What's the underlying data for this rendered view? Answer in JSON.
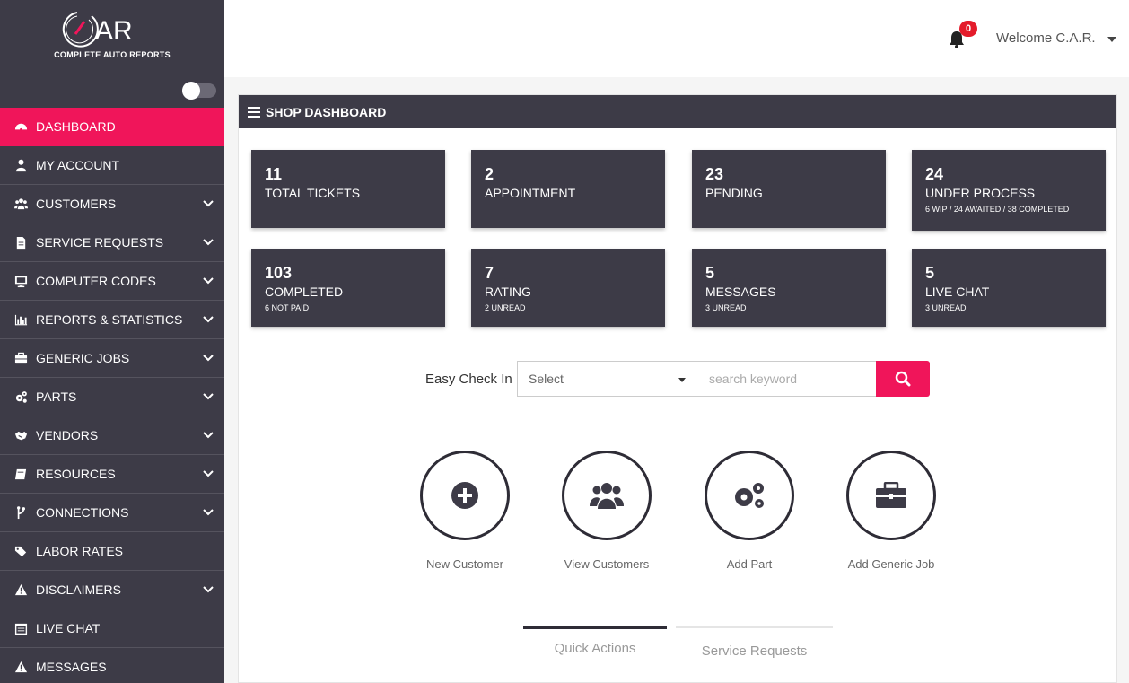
{
  "brand": {
    "logo_text": "AR",
    "subtitle": "COMPLETE AUTO REPORTS",
    "accent": "#f0155a",
    "dark": "#3d3b47"
  },
  "sidebar": {
    "items": [
      {
        "label": "DASHBOARD",
        "icon": "dashboard-icon",
        "active": true,
        "expandable": false
      },
      {
        "label": "MY ACCOUNT",
        "icon": "user-icon",
        "expandable": false
      },
      {
        "label": "CUSTOMERS",
        "icon": "users-icon",
        "expandable": true
      },
      {
        "label": "SERVICE REQUESTS",
        "icon": "document-icon",
        "expandable": true
      },
      {
        "label": "COMPUTER CODES",
        "icon": "monitor-icon",
        "expandable": true
      },
      {
        "label": "REPORTS & STATISTICS",
        "icon": "bar-chart-icon",
        "expandable": true
      },
      {
        "label": "GENERIC JOBS",
        "icon": "briefcase-icon",
        "expandable": true
      },
      {
        "label": "PARTS",
        "icon": "gears-icon",
        "expandable": true
      },
      {
        "label": "VENDORS",
        "icon": "handshake-icon",
        "expandable": true
      },
      {
        "label": "RESOURCES",
        "icon": "book-icon",
        "expandable": true
      },
      {
        "label": "CONNECTIONS",
        "icon": "fork-icon",
        "expandable": true
      },
      {
        "label": "LABOR RATES",
        "icon": "tags-icon",
        "expandable": false
      },
      {
        "label": "DISCLAIMERS",
        "icon": "warning-icon",
        "expandable": true
      },
      {
        "label": "LIVE CHAT",
        "icon": "calendar-icon",
        "expandable": false
      },
      {
        "label": "MESSAGES",
        "icon": "warning-icon",
        "expandable": false
      }
    ]
  },
  "header": {
    "notification_count": "0",
    "welcome": "Welcome C.A.R."
  },
  "panel": {
    "title": "SHOP DASHBOARD"
  },
  "cards": [
    {
      "num": "11",
      "label": "TOTAL TICKETS",
      "sub": ""
    },
    {
      "num": "2",
      "label": "APPOINTMENT",
      "sub": ""
    },
    {
      "num": "23",
      "label": "PENDING",
      "sub": ""
    },
    {
      "num": "24",
      "label": "UNDER PROCESS",
      "sub": "6 WIP / 24 AWAITED / 38 COMPLETED"
    },
    {
      "num": "103",
      "label": "COMPLETED",
      "sub": "6 NOT PAID"
    },
    {
      "num": "7",
      "label": "RATING",
      "sub": "2 UNREAD"
    },
    {
      "num": "5",
      "label": "MESSAGES",
      "sub": "3 UNREAD"
    },
    {
      "num": "5",
      "label": "LIVE CHAT",
      "sub": "3 UNREAD"
    }
  ],
  "checkin": {
    "label": "Easy Check In",
    "select_value": "Select",
    "search_placeholder": "search keyword"
  },
  "quick_actions": [
    {
      "label": "New Customer",
      "icon": "plus-circle-icon"
    },
    {
      "label": "View Customers",
      "icon": "users-icon"
    },
    {
      "label": "Add Part",
      "icon": "gears-icon"
    },
    {
      "label": "Add Generic Job",
      "icon": "briefcase-icon"
    }
  ],
  "tabs": [
    {
      "label": "Quick Actions",
      "active": true
    },
    {
      "label": "Service Requests",
      "active": false
    }
  ]
}
